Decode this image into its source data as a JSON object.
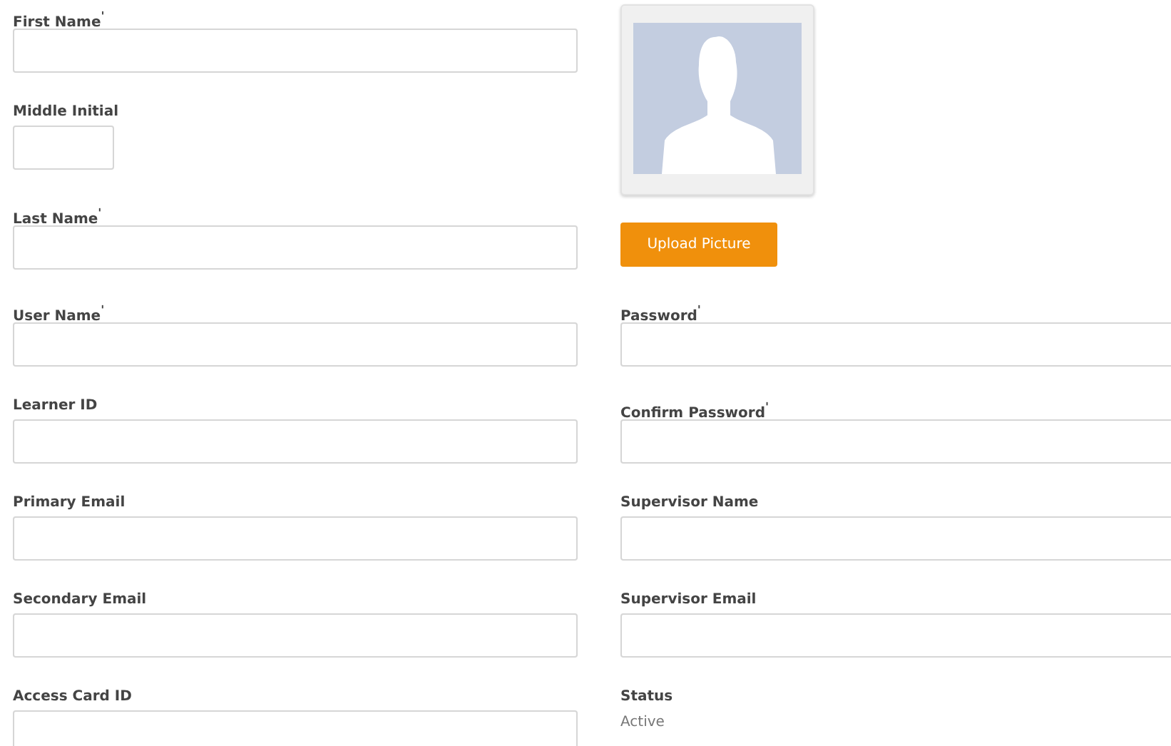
{
  "name_fields": [
    {
      "kind": "input",
      "label": "First Name$^{'}$"
    },
    {
      "kind": "short_input",
      "label": "Middle Initial"
    },
    {
      "kind": "input",
      "label": "Last Name$^{'}$"
    }
  ],
  "photo": {
    "kind": "picture"
  },
  "upload_button": "Upload Picture",
  "rows": [
    [
      {
        "kind": "input",
        "label": "User Name$^{'}$"
      },
      {
        "kind": "input",
        "label": "Password$^{'}$"
      }
    ],
    [
      {
        "kind": "input",
        "label": "Learner ID"
      },
      {
        "kind": "input",
        "label": "Confirm Password$^{'}$"
      }
    ],
    [
      {
        "kind": "input",
        "label": "Primary Email"
      },
      {
        "kind": "input",
        "label": "Supervisor Name"
      }
    ],
    [
      {
        "kind": "input",
        "label": "Secondary Email"
      },
      {
        "kind": "input",
        "label": "Supervisor Email"
      }
    ],
    [
      {
        "kind": "input",
        "label": "Access Card ID"
      },
      {
        "kind": "text",
        "label": "Status",
        "value": "Active"
      }
    ]
  ]
}
